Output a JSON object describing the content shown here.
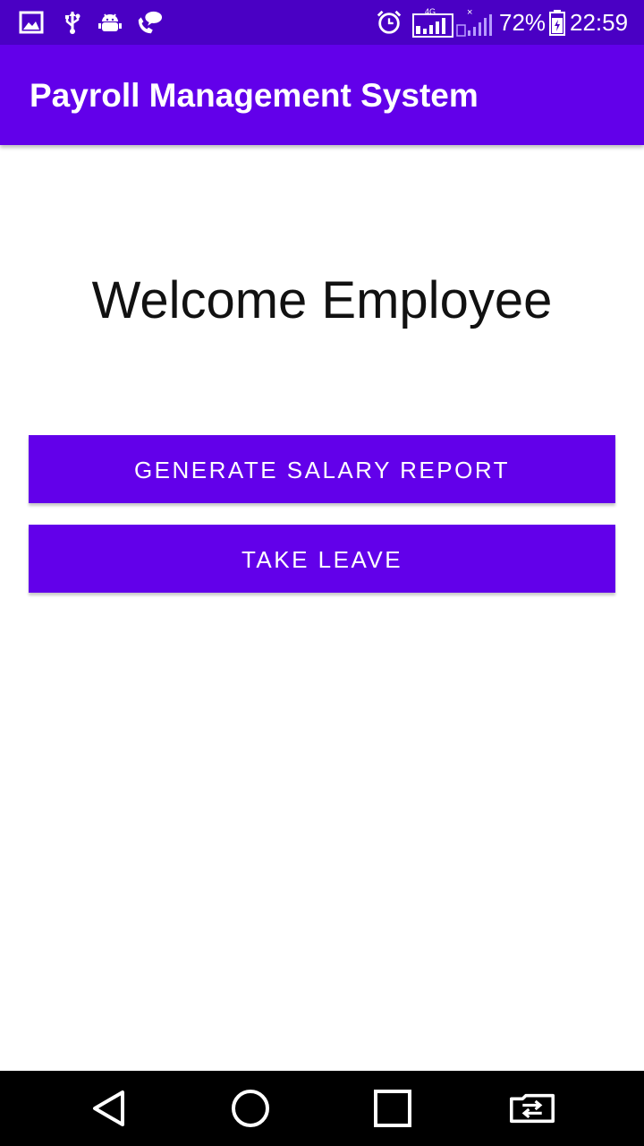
{
  "status_bar": {
    "battery_percent": "72%",
    "time": "22:59",
    "network_type": "4G",
    "sim2_marker": "×",
    "icons": [
      "image-icon",
      "usb-icon",
      "android-debug-icon",
      "call-chat-icon",
      "alarm-icon",
      "signal-sim1-icon",
      "signal-sim2-icon",
      "battery-icon"
    ],
    "background_color": "#4a00c4"
  },
  "app_bar": {
    "title": "Payroll Management System",
    "color": "#6200ea"
  },
  "main": {
    "welcome_text": "Welcome Employee",
    "buttons": {
      "generate_salary_report": "GENERATE SALARY REPORT",
      "take_leave": "TAKE LEAVE"
    },
    "button_color": "#6200ea"
  },
  "nav_bar": {
    "icons": [
      "back-icon",
      "home-icon",
      "recents-icon",
      "switch-sim-icon"
    ]
  }
}
